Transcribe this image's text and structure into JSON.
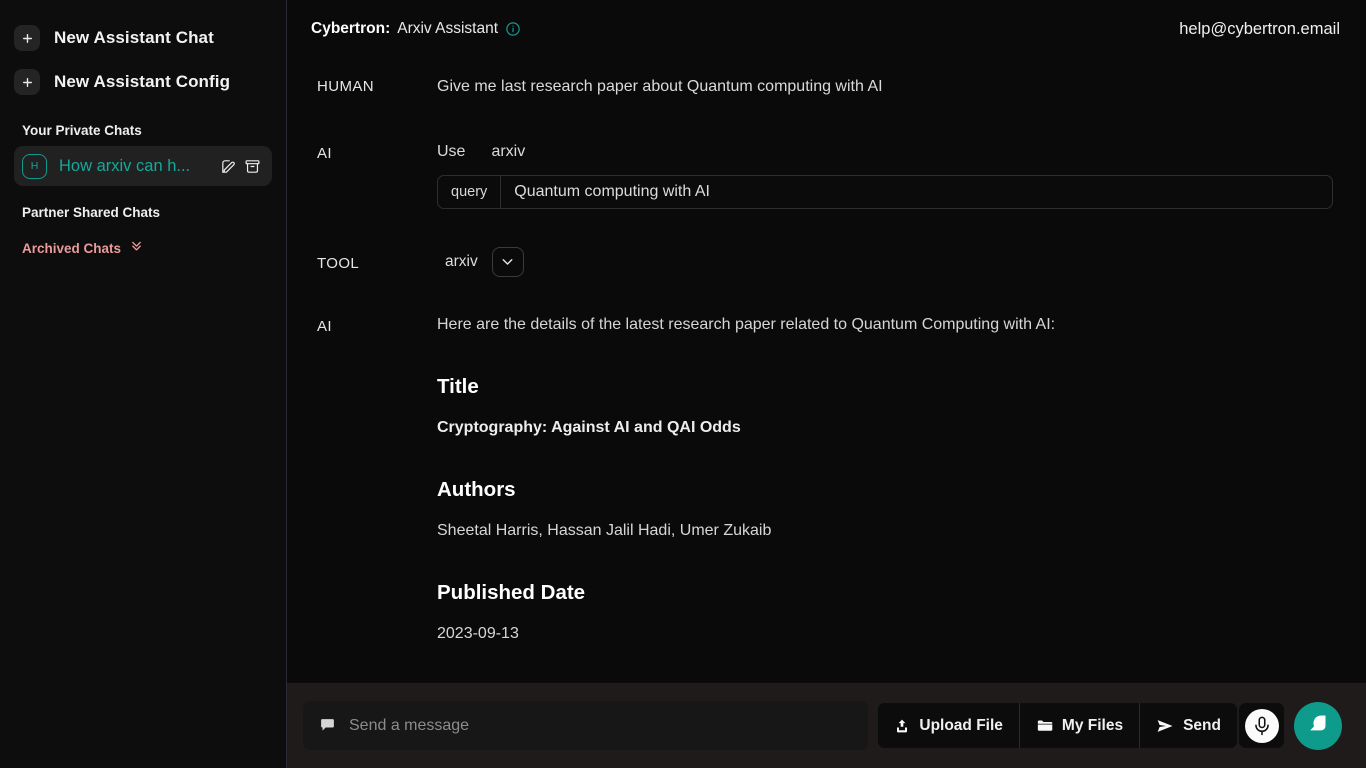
{
  "sidebar": {
    "new_chat_label": "New Assistant Chat",
    "new_config_label": "New Assistant Config",
    "private_section_label": "Your Private Chats",
    "partner_section_label": "Partner Shared Chats",
    "archived_label": "Archived Chats",
    "chats": [
      {
        "avatar": "H",
        "title": "How arxiv can h...",
        "selected": true
      }
    ],
    "accent_color": "#14a99a",
    "archived_color": "#eb9a9a"
  },
  "topbar": {
    "brand": "Cybertron:",
    "assistant_name": "Arxiv Assistant",
    "info_icon": "info-icon",
    "help_email": "help@cybertron.email"
  },
  "conversation": {
    "human": {
      "role": "HUMAN",
      "text": "Give me last research paper about Quantum computing with AI"
    },
    "ai_tool_call": {
      "role": "AI",
      "use_label": "Use",
      "tool_name": "arxiv",
      "param_key": "query",
      "param_value": "Quantum computing with AI"
    },
    "tool": {
      "role": "TOOL",
      "tool_name": "arxiv",
      "expand_icon": "chevron-down-icon"
    },
    "ai_answer": {
      "role": "AI",
      "intro": "Here are the details of the latest research paper related to Quantum Computing with AI:",
      "sections": [
        {
          "heading": "Title",
          "value": "Cryptography: Against AI and QAI Odds",
          "bold": true
        },
        {
          "heading": "Authors",
          "value": "Sheetal Harris, Hassan Jalil Hadi, Umer Zukaib",
          "bold": false
        },
        {
          "heading": "Published Date",
          "value": "2023-09-13",
          "bold": false
        }
      ]
    }
  },
  "footer": {
    "composer_placeholder": "Send a message",
    "composer_icon": "chat-bubble-icon",
    "buttons": [
      {
        "label": "Upload File",
        "icon": "upload-icon"
      },
      {
        "label": "My Files",
        "icon": "folder-icon"
      },
      {
        "label": "Send",
        "icon": "paper-plane-icon"
      }
    ],
    "mic_icon": "microphone-icon",
    "fab_icon": "chat-bubble-icon",
    "fab_color": "#0e9b8c"
  }
}
